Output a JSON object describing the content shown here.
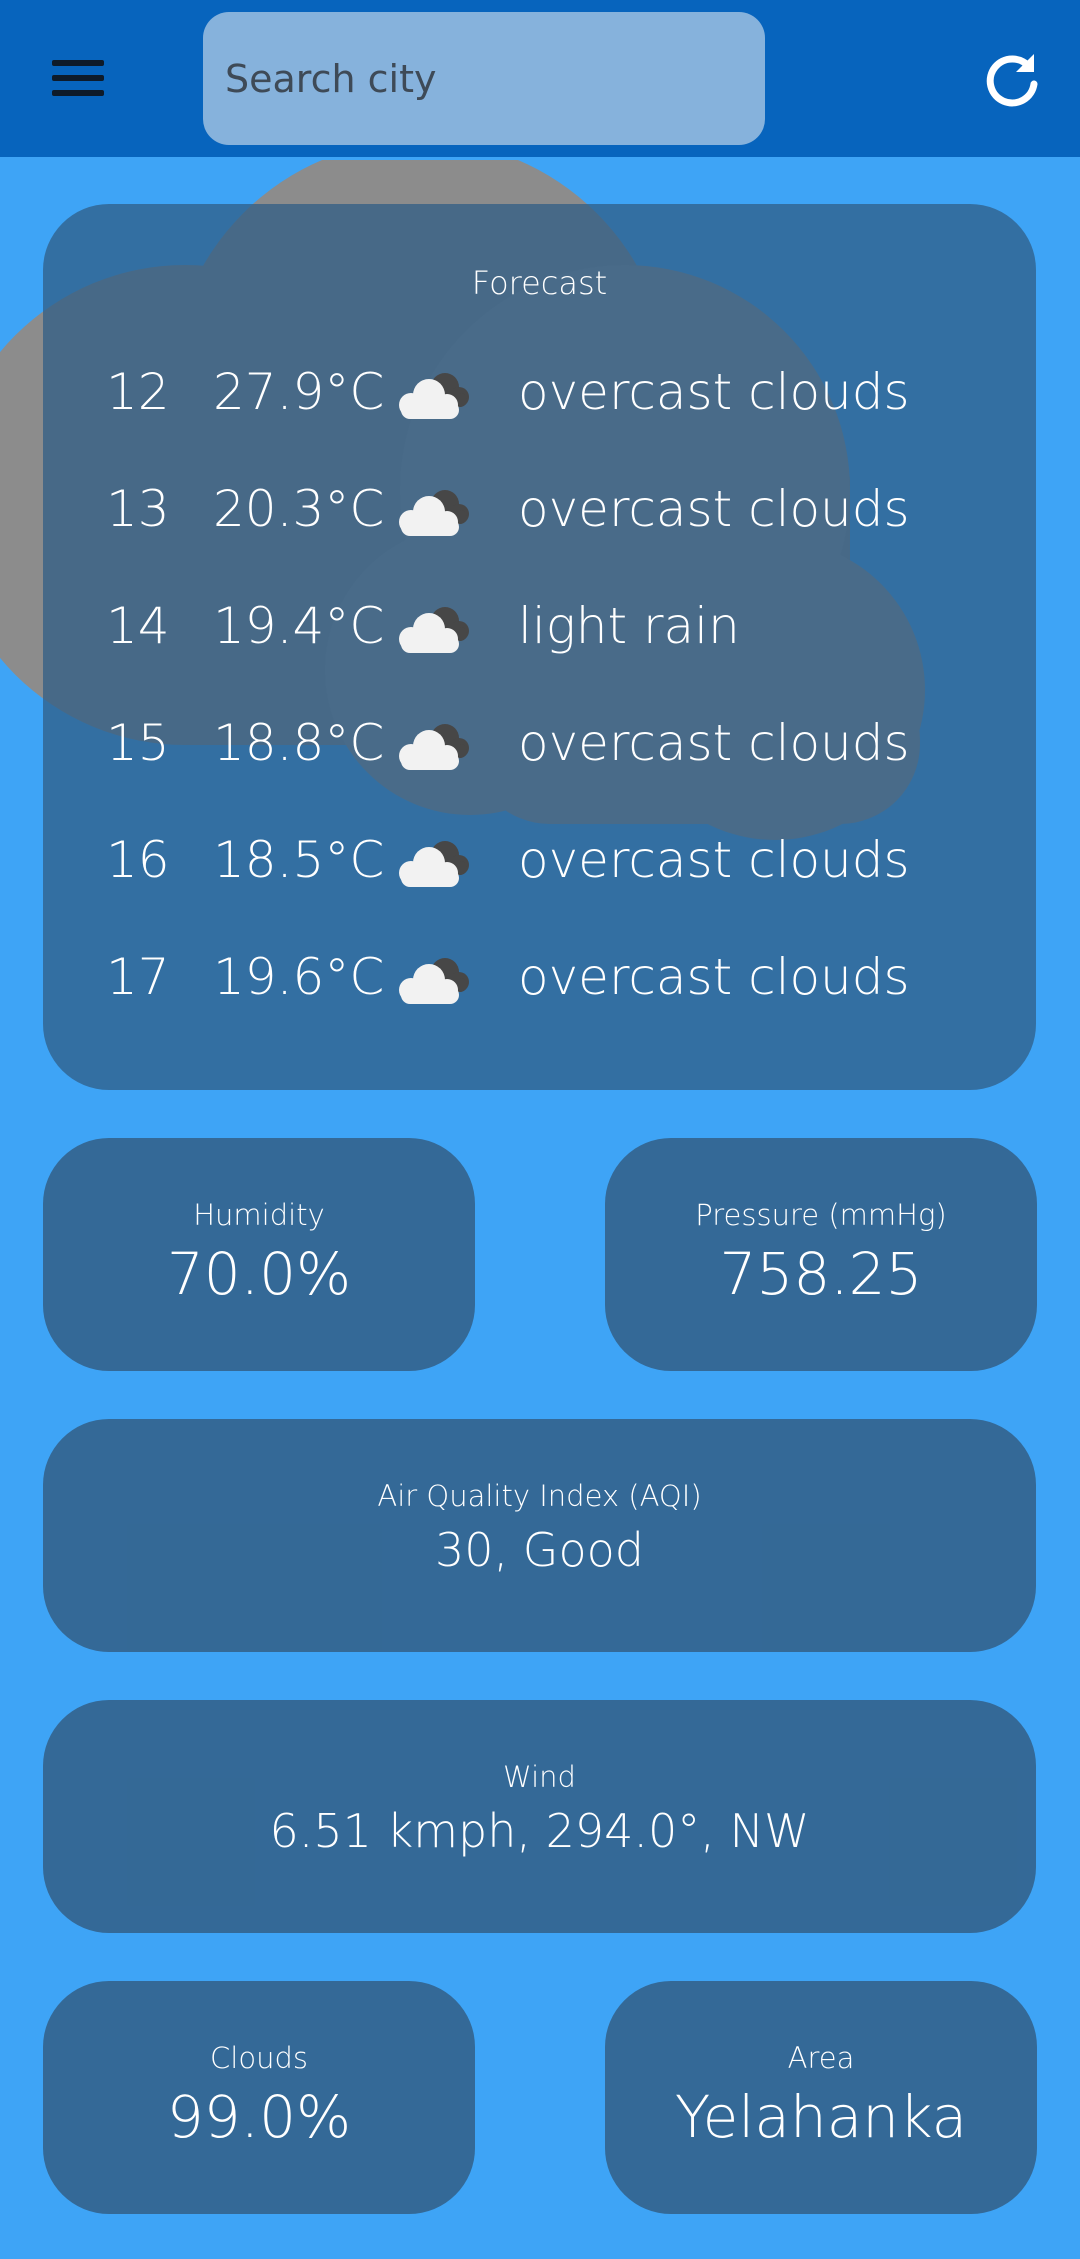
{
  "header": {
    "menu_icon": "hamburger-menu-icon",
    "search_placeholder": "Search city",
    "search_value": "",
    "refresh_icon": "refresh-icon"
  },
  "forecast": {
    "title": "Forecast",
    "rows": [
      {
        "day": "12",
        "temp": "27.9°C",
        "icon": "overcast-cloud-icon",
        "desc": "overcast clouds"
      },
      {
        "day": "13",
        "temp": "20.3°C",
        "icon": "overcast-cloud-icon",
        "desc": "overcast clouds"
      },
      {
        "day": "14",
        "temp": "19.4°C",
        "icon": "overcast-cloud-icon",
        "desc": "light rain"
      },
      {
        "day": "15",
        "temp": "18.8°C",
        "icon": "overcast-cloud-icon",
        "desc": "overcast clouds"
      },
      {
        "day": "16",
        "temp": "18.5°C",
        "icon": "overcast-cloud-icon",
        "desc": "overcast clouds"
      },
      {
        "day": "17",
        "temp": "19.6°C",
        "icon": "overcast-cloud-icon",
        "desc": "overcast clouds"
      }
    ]
  },
  "humidity": {
    "label": "Humidity",
    "value": "70.0%"
  },
  "pressure": {
    "label": "Pressure (mmHg)",
    "value": "758.25"
  },
  "aqi": {
    "label": "Air Quality Index (AQI)",
    "value": "30, Good"
  },
  "wind": {
    "label": "Wind",
    "value": "6.51 kmph, 294.0°, NW"
  },
  "clouds": {
    "label": "Clouds",
    "value": "99.0%"
  },
  "area": {
    "label": "Area",
    "value": "Yelahanka"
  },
  "colors": {
    "background": "#3EA4F6",
    "topbar": "#0764BD",
    "search_box": "#86B2DC",
    "card": "#33648E",
    "text": "#FFFFFF"
  }
}
